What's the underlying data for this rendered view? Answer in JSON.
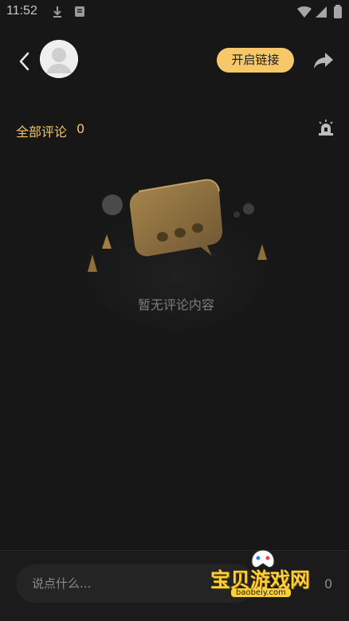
{
  "status_bar": {
    "time": "11:52",
    "icons": [
      "download-icon",
      "notification-icon",
      "wifi-icon",
      "signal-icon",
      "battery-icon"
    ]
  },
  "top_bar": {
    "open_link_label": "开启链接",
    "icons": {
      "back": "chevron-left-icon",
      "share": "share-icon",
      "avatar": "user-avatar"
    }
  },
  "comments": {
    "title": "全部评论",
    "count": "0",
    "alarm_icon": "alarm-icon"
  },
  "empty_state": {
    "message": "暂无评论内容"
  },
  "bottom_bar": {
    "input_placeholder": "说点什么...",
    "count": "0"
  },
  "watermark": {
    "brand": "宝贝游戏网",
    "site": "baobeiy.com"
  },
  "colors": {
    "background": "#171717",
    "accent": "#f7c86a",
    "accent_text": "#f4c366",
    "muted_text": "#7d7d7d"
  }
}
